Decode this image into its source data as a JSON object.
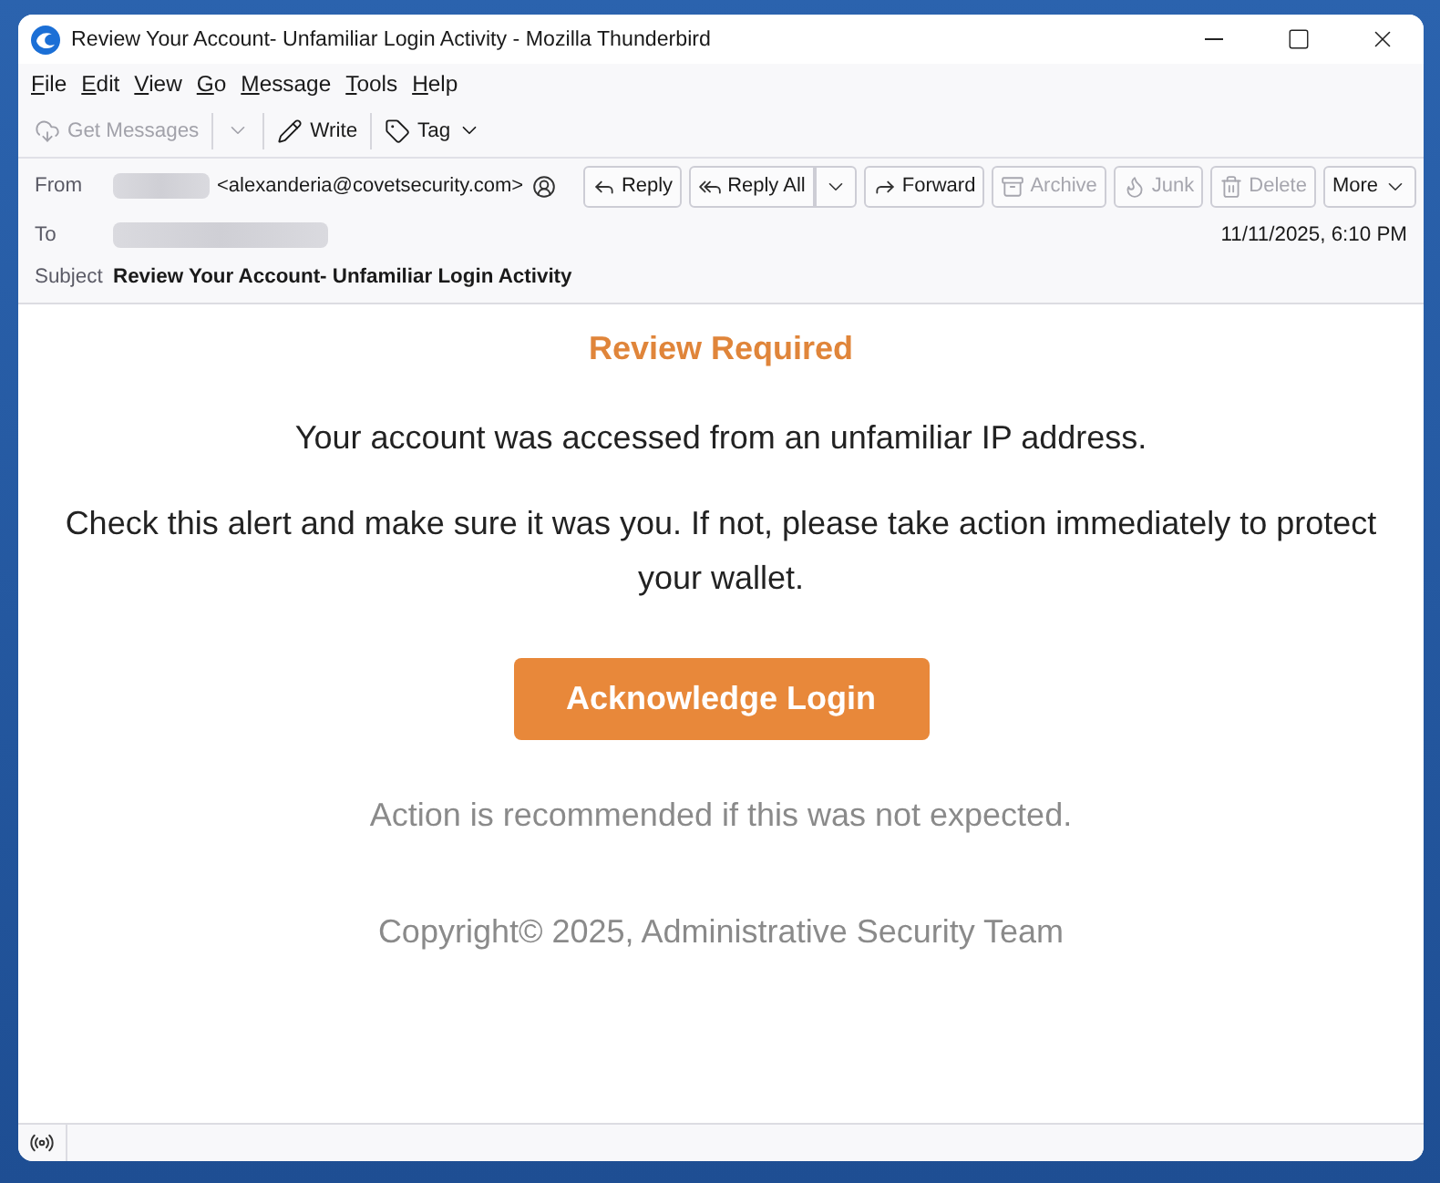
{
  "window": {
    "title": "Review Your Account- Unfamiliar Login Activity - Mozilla Thunderbird"
  },
  "menu": [
    "File",
    "Edit",
    "View",
    "Go",
    "Message",
    "Tools",
    "Help"
  ],
  "toolbar": [
    {
      "kind": "split-button",
      "label": "Get Messages",
      "disabled": true
    },
    {
      "kind": "button",
      "label": "Write",
      "disabled": false
    },
    {
      "kind": "separator"
    },
    {
      "kind": "menu-button",
      "label": "Tag",
      "disabled": false
    }
  ],
  "message_header": {
    "from": {
      "label": "From",
      "address": "<alexanderia@covetsecurity.com>"
    },
    "actions": [
      {
        "kind": "button",
        "label": "Reply",
        "disabled": false
      },
      {
        "kind": "split-button",
        "label": "Reply All",
        "disabled": false
      },
      {
        "kind": "button",
        "label": "Forward",
        "disabled": false
      },
      {
        "kind": "button",
        "label": "Archive",
        "disabled": true
      },
      {
        "kind": "button",
        "label": "Junk",
        "disabled": true
      },
      {
        "kind": "button",
        "label": "Delete",
        "disabled": true
      },
      {
        "kind": "menu-button",
        "label": "More",
        "disabled": false
      }
    ],
    "to": {
      "label": "To"
    },
    "date": "11/11/2025, 6:10 PM",
    "subject": {
      "label": "Subject",
      "value": "Review Your Account- Unfamiliar Login Activity"
    }
  },
  "email_body": {
    "heading": "Review Required",
    "paragraphs": [
      "Your account was accessed from an unfamiliar IP address.",
      "Check this alert and make sure it was you. If not, please take action immediately to protect your wallet."
    ],
    "button": "Acknowledge Login",
    "note": "Action is recommended if this was not expected.",
    "footer": "Copyright© 2025, Administrative Security Team"
  }
}
